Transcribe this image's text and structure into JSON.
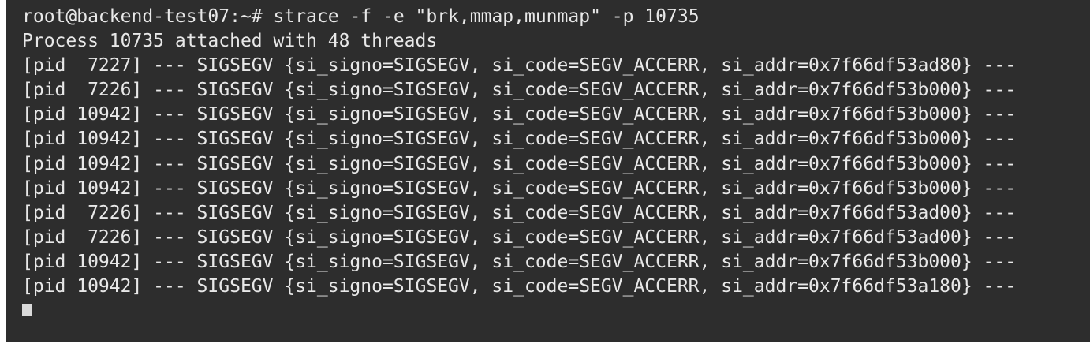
{
  "terminal": {
    "prompt": "root@backend-test07:~# ",
    "command": "strace -f -e \"brk,mmap,munmap\" -p 10735",
    "lines": [
      "Process 10735 attached with 48 threads",
      "[pid  7227] --- SIGSEGV {si_signo=SIGSEGV, si_code=SEGV_ACCERR, si_addr=0x7f66df53ad80} ---",
      "[pid  7226] --- SIGSEGV {si_signo=SIGSEGV, si_code=SEGV_ACCERR, si_addr=0x7f66df53b000} ---",
      "[pid 10942] --- SIGSEGV {si_signo=SIGSEGV, si_code=SEGV_ACCERR, si_addr=0x7f66df53b000} ---",
      "[pid 10942] --- SIGSEGV {si_signo=SIGSEGV, si_code=SEGV_ACCERR, si_addr=0x7f66df53b000} ---",
      "[pid 10942] --- SIGSEGV {si_signo=SIGSEGV, si_code=SEGV_ACCERR, si_addr=0x7f66df53b000} ---",
      "[pid 10942] --- SIGSEGV {si_signo=SIGSEGV, si_code=SEGV_ACCERR, si_addr=0x7f66df53b000} ---",
      "[pid  7226] --- SIGSEGV {si_signo=SIGSEGV, si_code=SEGV_ACCERR, si_addr=0x7f66df53ad00} ---",
      "[pid  7226] --- SIGSEGV {si_signo=SIGSEGV, si_code=SEGV_ACCERR, si_addr=0x7f66df53ad00} ---",
      "[pid 10942] --- SIGSEGV {si_signo=SIGSEGV, si_code=SEGV_ACCERR, si_addr=0x7f66df53b000} ---",
      "[pid 10942] --- SIGSEGV {si_signo=SIGSEGV, si_code=SEGV_ACCERR, si_addr=0x7f66df53a180} ---"
    ],
    "colors": {
      "background": "#2d2d2d",
      "text": "#e8e8e8",
      "cursor": "#d9d9d9"
    }
  }
}
